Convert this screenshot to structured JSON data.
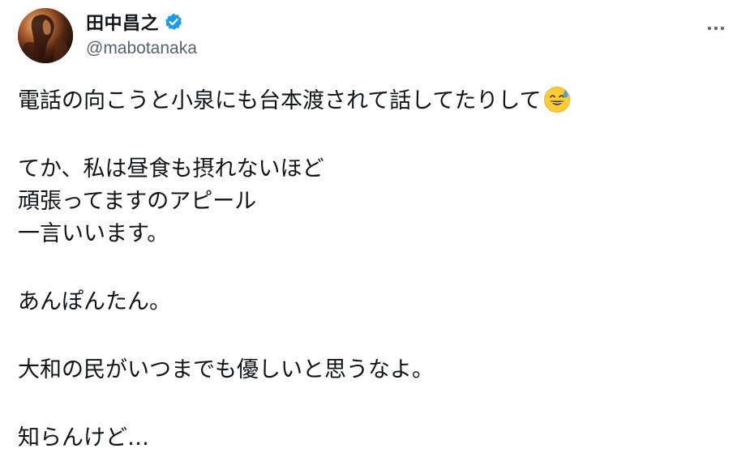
{
  "author": {
    "display_name": "田中昌之",
    "handle": "@mabotanaka",
    "verified_icon": "verified-badge-icon",
    "avatar_icon": "avatar-image"
  },
  "menu": {
    "icon": "more-options-icon"
  },
  "tweet": {
    "lines": [
      "電話の向こうと小泉にも台本渡されて話してたりして",
      "てか、私は昼食も摂れないほど",
      "頑張ってますのアピール",
      "一言いいます。",
      "あんぽんたん。",
      "大和の民がいつまでも優しいと思うなよ。",
      "知らんけど…"
    ],
    "emoji": "grinning-face-with-sweat-icon"
  },
  "colors": {
    "text": "#0f1419",
    "secondary": "#536471",
    "verified": "#1d9bf0"
  }
}
